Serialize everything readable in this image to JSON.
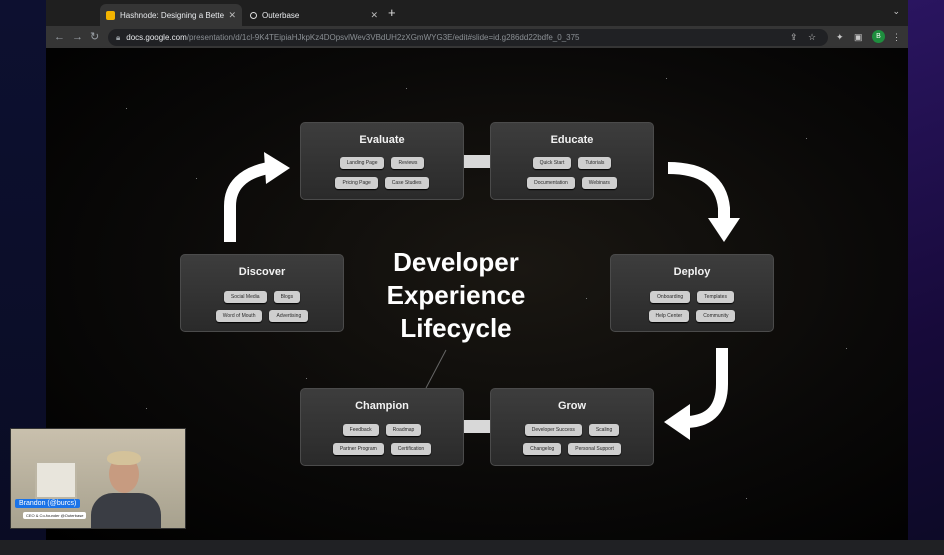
{
  "browser": {
    "tabs": [
      {
        "title": "Hashnode: Designing a Bette",
        "icon": "hashnode-icon",
        "active": true
      },
      {
        "title": "Outerbase",
        "icon": "outerbase-icon",
        "active": false
      }
    ],
    "url_domain": "docs.google.com",
    "url_path": "/presentation/d/1cl-9K4TEipiaHJkpKz4DOpsvlWev3VBdUH2zXGmWYG3E/edit#slide=id.g286dd22bdfe_0_375",
    "profile_initial": "B"
  },
  "slide": {
    "title_lines": [
      "Developer",
      "Experience",
      "Lifecycle"
    ],
    "stages": [
      {
        "name": "Evaluate",
        "chips": [
          [
            "Landing Page",
            "Reviews"
          ],
          [
            "Pricing Page",
            "Case Studies"
          ]
        ]
      },
      {
        "name": "Educate",
        "chips": [
          [
            "Quick Start",
            "Tutorials"
          ],
          [
            "Documentation",
            "Webinars"
          ]
        ]
      },
      {
        "name": "Deploy",
        "chips": [
          [
            "Onboarding",
            "Templates"
          ],
          [
            "Help Center",
            "Community"
          ]
        ]
      },
      {
        "name": "Grow",
        "chips": [
          [
            "Developer Success",
            "Scaling"
          ],
          [
            "Changelog",
            "Personal Support"
          ]
        ]
      },
      {
        "name": "Champion",
        "chips": [
          [
            "Feedback",
            "Roadmap"
          ],
          [
            "Partner Program",
            "Certification"
          ]
        ]
      },
      {
        "name": "Discover",
        "chips": [
          [
            "Social Media",
            "Blogs"
          ],
          [
            "Word of Mouth",
            "Advertising"
          ]
        ]
      }
    ]
  },
  "webcam": {
    "name": "Brandon (@burcs)",
    "role": "CEO & Co-founder @Outerbase"
  },
  "colors": {
    "chip_bg": "#cfcfcf",
    "card_bg": "#333333",
    "arrow": "#ffffff",
    "name_tag": "#1a73e8"
  }
}
